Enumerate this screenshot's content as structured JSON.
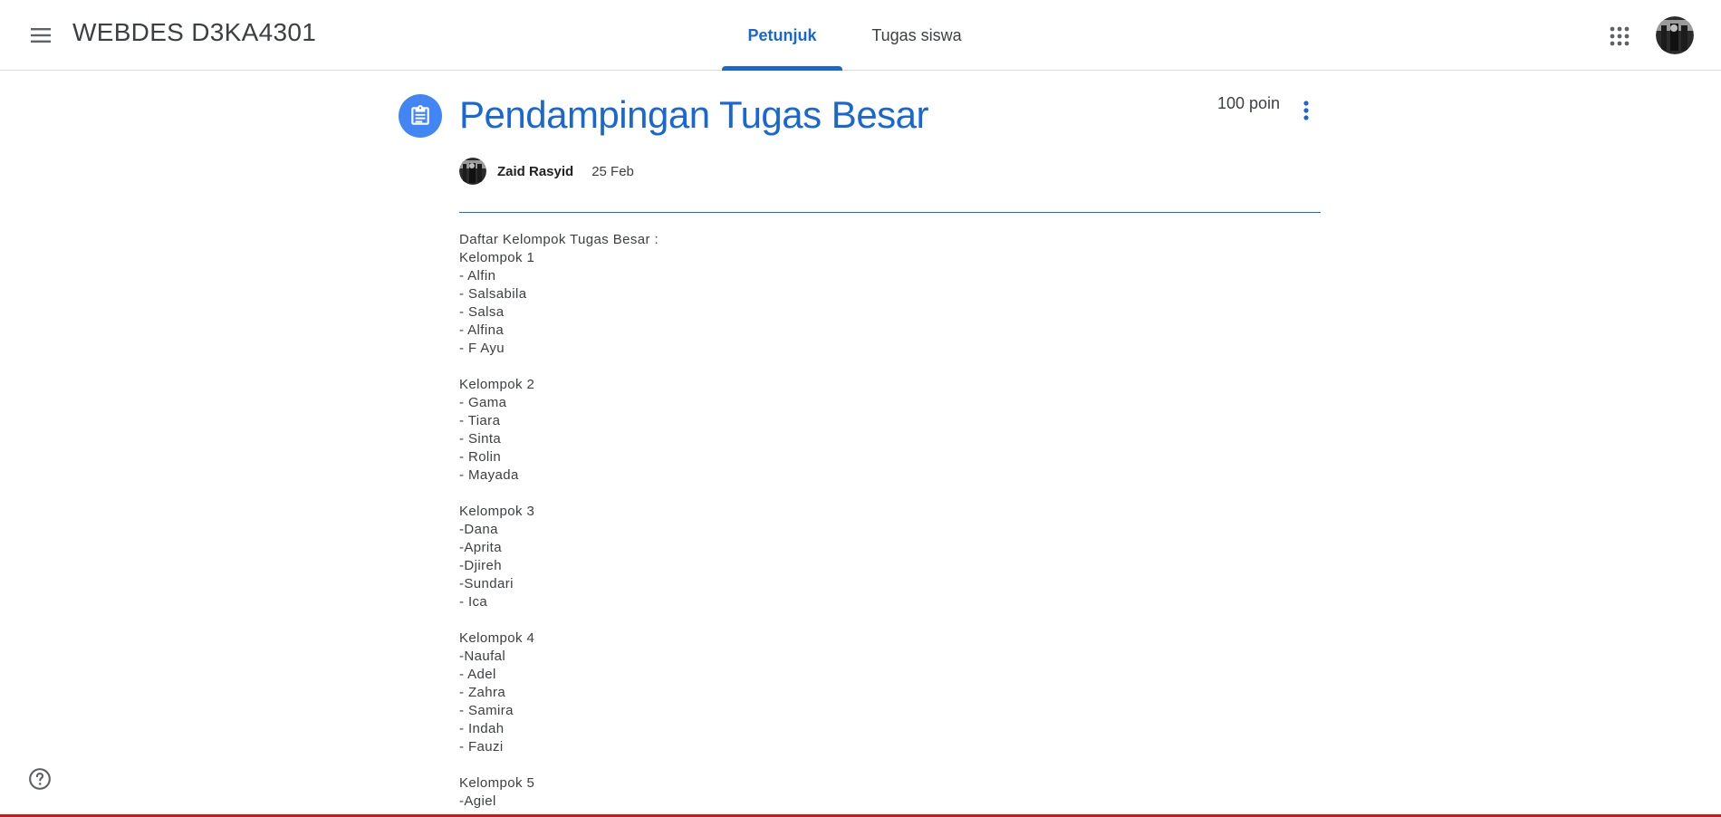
{
  "header": {
    "menu_icon": "hamburger-menu-icon",
    "class_name": "WEBDES D3KA4301",
    "tabs": [
      {
        "label": "Petunjuk",
        "active": true
      },
      {
        "label": "Tugas siswa",
        "active": false
      }
    ],
    "apps_icon": "apps-grid-icon",
    "account_icon": "account-avatar"
  },
  "assignment": {
    "icon": "assignment-clipboard-icon",
    "title": "Pendampingan Tugas Besar",
    "points": "100 poin",
    "more_icon": "more-vert-icon",
    "author": "Zaid Rasyid",
    "date": "25 Feb",
    "body_lines": [
      "Daftar Kelompok Tugas Besar :",
      "Kelompok 1",
      "- Alfin",
      "- Salsabila",
      "- Salsa",
      "- Alfina",
      "- F Ayu",
      "",
      "Kelompok 2",
      "- Gama",
      "- Tiara",
      "- Sinta",
      "- Rolin",
      "- Mayada",
      "",
      "Kelompok 3",
      "-Dana",
      "-Aprita",
      "-Djireh",
      "-Sundari",
      "- Ica",
      "",
      "Kelompok 4",
      "-Naufal",
      "- Adel",
      "- Zahra",
      "- Samira",
      "- Indah",
      "- Fauzi",
      "",
      "Kelompok 5",
      "-Agiel"
    ]
  },
  "footer": {
    "help_icon": "help-icon"
  },
  "colors": {
    "accent": "#1967d2",
    "icon_circle": "#4285f4",
    "text": "#3c4043",
    "bottom_bar": "#d01716"
  }
}
